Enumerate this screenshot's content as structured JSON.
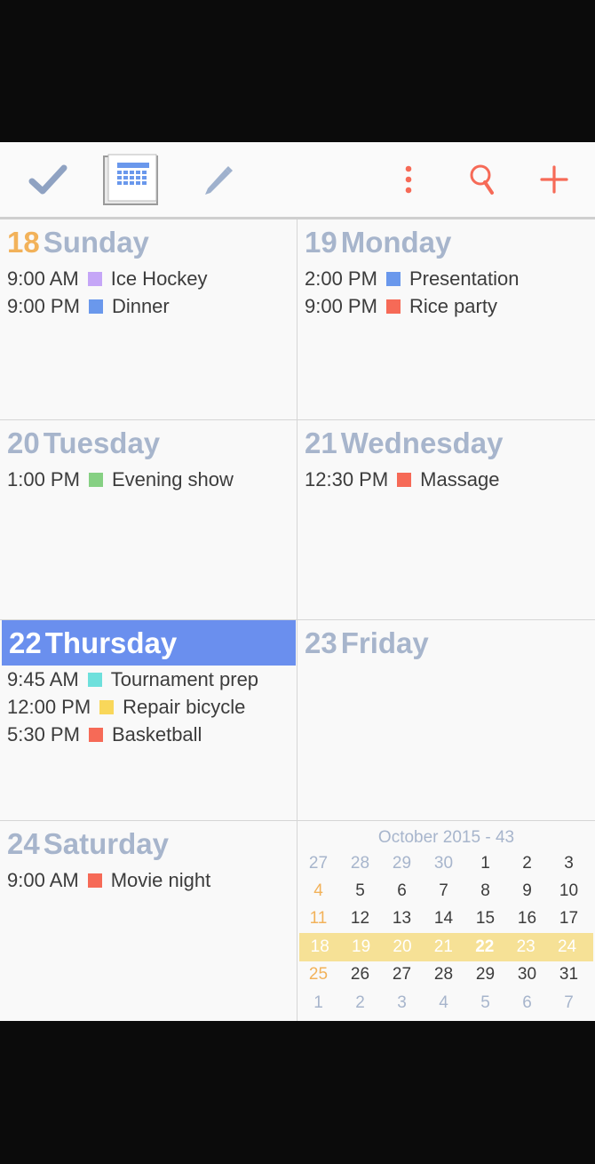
{
  "toolbar": {
    "icons": [
      "check-icon",
      "calendar-week-icon",
      "pencil-icon",
      "more-vert-icon",
      "search-icon",
      "plus-icon"
    ]
  },
  "colors": {
    "accent": "#6a8fee",
    "orange": "#f2b25a",
    "grey_text": "#a7b5cc",
    "highlight_week": "#f6e196",
    "purple": "#c5a6f7",
    "blue": "#6a98ec",
    "red": "#f66a57",
    "green": "#86d083",
    "cyan": "#6ee0dc",
    "yellow": "#f9d75a"
  },
  "days": [
    {
      "num": "18",
      "name": "Sunday",
      "events": [
        {
          "time": "9:00 AM",
          "title": "Ice Hockey",
          "color": "#c5a6f7"
        },
        {
          "time": "9:00 PM",
          "title": "Dinner",
          "color": "#6a98ec"
        }
      ]
    },
    {
      "num": "19",
      "name": "Monday",
      "events": [
        {
          "time": "2:00 PM",
          "title": "Presentation",
          "color": "#6a98ec"
        },
        {
          "time": "9:00 PM",
          "title": "Rice party",
          "color": "#f66a57"
        }
      ]
    },
    {
      "num": "20",
      "name": "Tuesday",
      "events": [
        {
          "time": "1:00 PM",
          "title": "Evening show",
          "color": "#86d083"
        }
      ]
    },
    {
      "num": "21",
      "name": "Wednesday",
      "events": [
        {
          "time": "12:30 PM",
          "title": "Massage",
          "color": "#f66a57"
        }
      ]
    },
    {
      "num": "22",
      "name": "Thursday",
      "events": [
        {
          "time": "9:45 AM",
          "title": "Tournament prep",
          "color": "#6ee0dc"
        },
        {
          "time": "12:00 PM",
          "title": "Repair bicycle",
          "color": "#f9d75a"
        },
        {
          "time": "5:30 PM",
          "title": "Basketball",
          "color": "#f66a57"
        }
      ]
    },
    {
      "num": "23",
      "name": "Friday",
      "events": []
    },
    {
      "num": "24",
      "name": "Saturday",
      "events": [
        {
          "time": "9:00 AM",
          "title": "Movie night",
          "color": "#f66a57"
        }
      ]
    }
  ],
  "mini_calendar": {
    "title": "October 2015  -  43",
    "weeks": [
      [
        "27",
        "28",
        "29",
        "30",
        "1",
        "2",
        "3"
      ],
      [
        "4",
        "5",
        "6",
        "7",
        "8",
        "9",
        "10"
      ],
      [
        "11",
        "12",
        "13",
        "14",
        "15",
        "16",
        "17"
      ],
      [
        "18",
        "19",
        "20",
        "21",
        "22",
        "23",
        "24"
      ],
      [
        "25",
        "26",
        "27",
        "28",
        "29",
        "30",
        "31"
      ],
      [
        "1",
        "2",
        "3",
        "4",
        "5",
        "6",
        "7"
      ]
    ]
  }
}
